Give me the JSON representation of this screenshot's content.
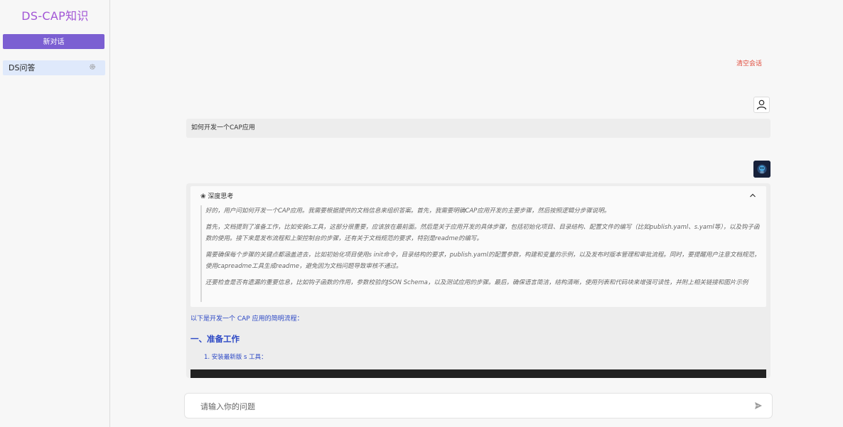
{
  "sidebar": {
    "app_title": "DS-CAP知识",
    "new_chat_label": "新对话",
    "conversations": [
      {
        "label": "DS问答",
        "icon": "gear-icon"
      }
    ]
  },
  "header": {
    "clear_label": "清空会话"
  },
  "chat": {
    "user_avatar_icon": "user-icon",
    "user_message": "如何开发一个CAP应用",
    "bot_avatar_icon": "bot-avatar-icon",
    "thinking": {
      "title": "❀ 深度思考",
      "toggle_icon": "chevron-up-icon",
      "paragraphs": [
        "好的，用户问如何开发一个CAP应用。我需要根据提供的文档信息来组织答案。首先，我需要明确CAP应用开发的主要步骤，然后按照逻辑分步骤说明。",
        "首先，文档提到了准备工作，比如安装s工具，这部分很重要，应该放在最前面。然后是关于应用开发的具体步骤，包括初始化项目、目录结构、配置文件的编写（比如publish.yaml、s.yaml等），以及钩子函数的使用。接下来是发布流程和上架控制台的步骤，还有关于文档规范的要求，特别是readme的编写。",
        "需要确保每个步骤的关键点都涵盖进去，比如初始化项目使用s init命令，目录结构的要求，publish.yaml的配置参数，构建和变量的示例，以及发布时版本管理和审批流程。同时，要提醒用户注意文档规范，使用capreadme工具生成readme，避免因为文档问题导致审核不通过。",
        "还要检查是否有遗漏的重要信息，比如钩子函数的作用，参数校验的JSON Schema，以及测试应用的步骤。最后，确保语言简洁，结构清晰，使用列表和代码块来增强可读性，并附上相关链接和图片示例"
      ]
    },
    "answer": {
      "intro": "以下是开发一个 CAP 应用的简明流程：",
      "heading": "一、准备工作",
      "list_item": "1. 安装最新版 s 工具："
    }
  },
  "input": {
    "placeholder": "请输入你的问题",
    "send_icon": "send-icon"
  },
  "colors": {
    "accent": "#7b5fd2",
    "title": "#a256d6",
    "danger": "#e04b3b",
    "link": "#2c48c5"
  }
}
